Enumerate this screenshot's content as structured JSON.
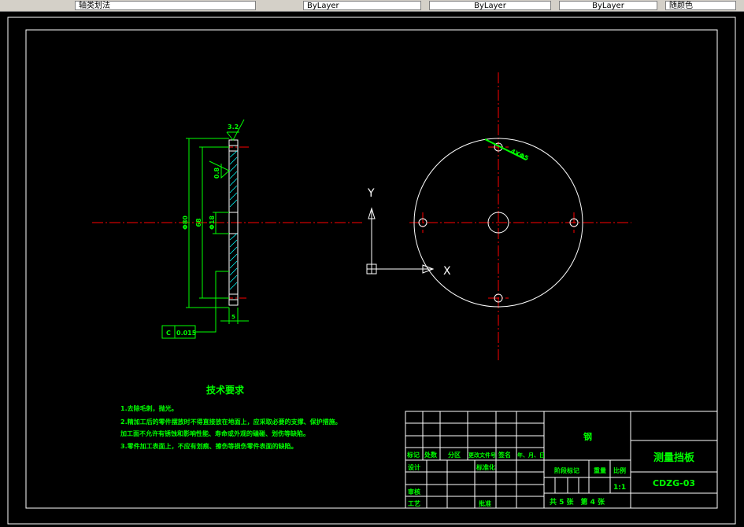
{
  "toolbar": {
    "layer_name": "轴类划法",
    "color": "ByLayer",
    "linetype": "ByLayer",
    "lineweight": "ByLayer",
    "plot_style": "随颜色"
  },
  "drawing": {
    "dimensions": {
      "outer_diameter": "Φ80",
      "pitch_diameter": "68",
      "center_hole": "Φ18",
      "thickness": "5",
      "roughness_top": "3.2",
      "roughness_face": "0.8",
      "tolerance_symbol": "C",
      "tolerance_value": "0.015",
      "hole_note": "4XΦ5"
    },
    "ucs": {
      "x": "X",
      "y": "Y"
    },
    "tech_requirements": {
      "title": "技术要求",
      "lines": [
        "1.去除毛刺，抛光。",
        "2.精加工后的零件摆放时不得直接放在地面上，应采取必要的支撑、保护措施。",
        "加工面不允许有锈蚀和影响性能、寿命或外观的磕碰、划伤等缺陷。",
        "3.零件加工表面上，不应有划痕、擦伤等损伤零件表面的缺陷。"
      ]
    },
    "title_block": {
      "headers": [
        "标记",
        "处数",
        "分区",
        "更改文件号",
        "签名",
        "年、月、日"
      ],
      "design": "设计",
      "standardization": "标准化",
      "review": "审核",
      "process": "工艺",
      "approve": "批准",
      "material": "钢",
      "stage_mark": "阶段标记",
      "weight": "重量",
      "scale_label": "比例",
      "scale": "1:1",
      "sheets": "共 5 张　第 4 张",
      "part_name": "测量挡板",
      "drawing_no": "CDZG-03"
    }
  }
}
